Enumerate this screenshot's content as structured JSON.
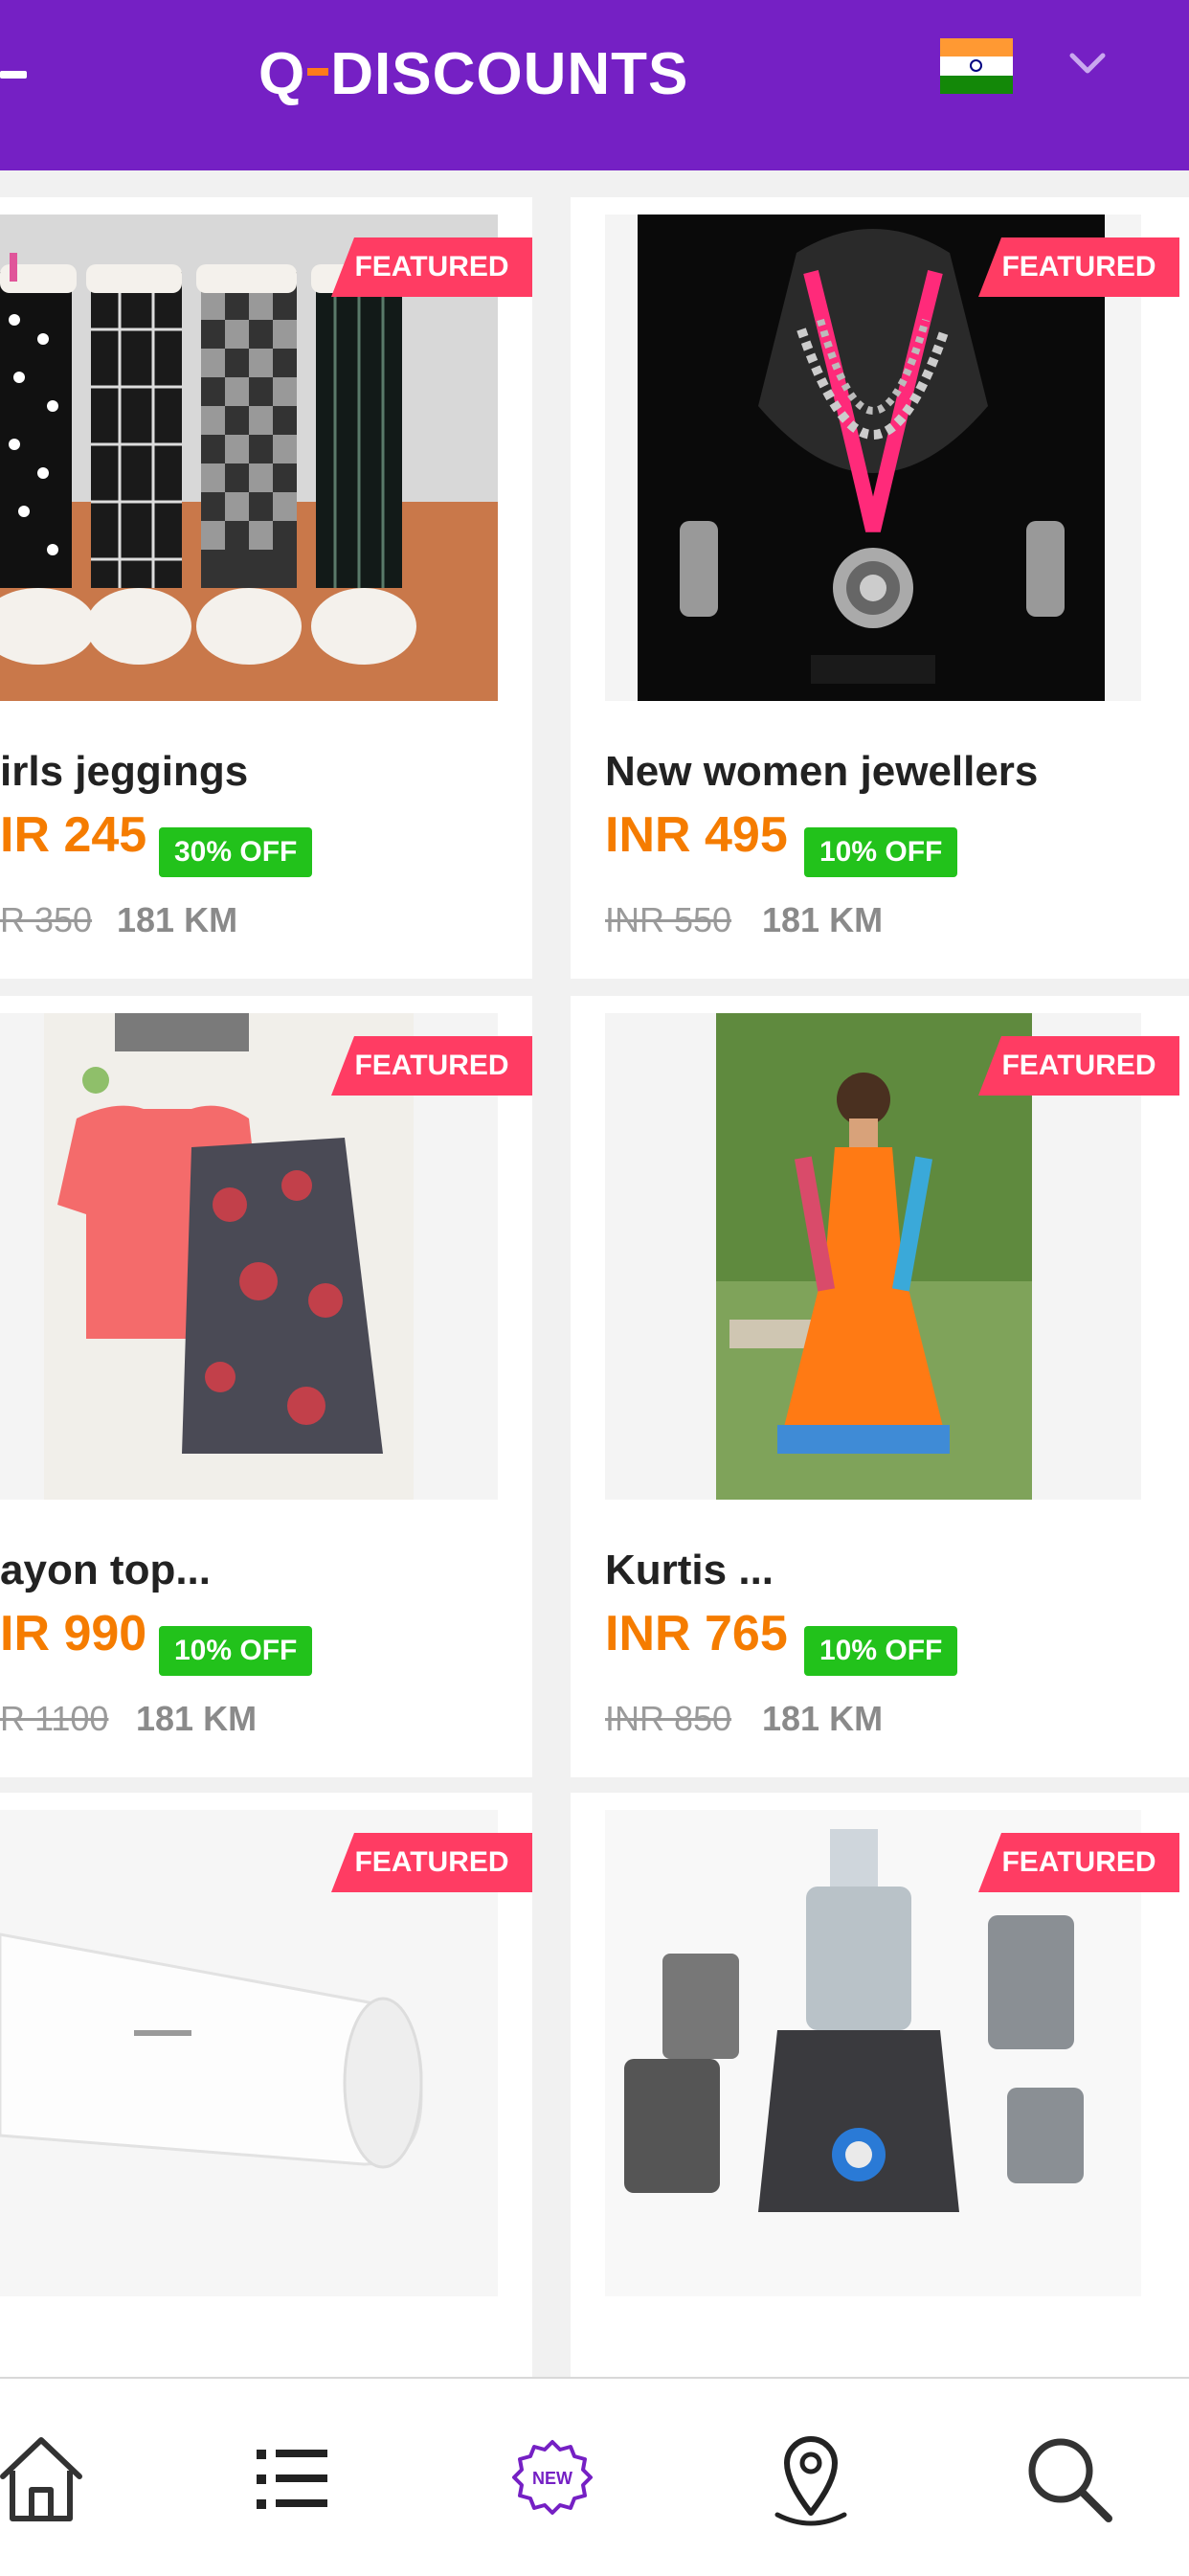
{
  "header": {
    "brand": "Q-DISCOUNTS",
    "brand_parts": {
      "first": "Q",
      "rest": "DISCOUNTS"
    },
    "country_flag": "india-flag-icon",
    "dropdown_icon": "chevron-down-icon",
    "colors": {
      "bar": "#7520c4",
      "accent": "#ff7a1a"
    }
  },
  "products": [
    {
      "badge": "FEATURED",
      "title": "irls jeggings",
      "price": "IR 245",
      "discount": "30% OFF",
      "old_price": "R 350",
      "distance": "181 KM"
    },
    {
      "badge": "FEATURED",
      "title": "New women jewellers",
      "price": "INR 495",
      "discount": "10% OFF",
      "old_price": "INR 550",
      "distance": "181 KM"
    },
    {
      "badge": "FEATURED",
      "title": "ayon top...",
      "price": "IR 990",
      "discount": "10% OFF",
      "old_price": "R 1100",
      "distance": "181 KM"
    },
    {
      "badge": "FEATURED",
      "title": "Kurtis ...",
      "price": "INR 765",
      "discount": "10% OFF",
      "old_price": "INR 850",
      "distance": "181 KM"
    },
    {
      "badge": "FEATURED",
      "title": "",
      "price": "",
      "discount": "",
      "old_price": "",
      "distance": ""
    },
    {
      "badge": "FEATURED",
      "title": "",
      "price": "",
      "discount": "",
      "old_price": "",
      "distance": ""
    }
  ],
  "bottom_nav": {
    "items": [
      {
        "icon": "home-icon"
      },
      {
        "icon": "list-icon"
      },
      {
        "icon": "new-badge-icon",
        "label": "NEW"
      },
      {
        "icon": "location-pin-icon"
      },
      {
        "icon": "search-icon"
      }
    ]
  },
  "colors": {
    "badge": "#ff3c63",
    "price": "#f57c00",
    "discount": "#22c21b"
  }
}
